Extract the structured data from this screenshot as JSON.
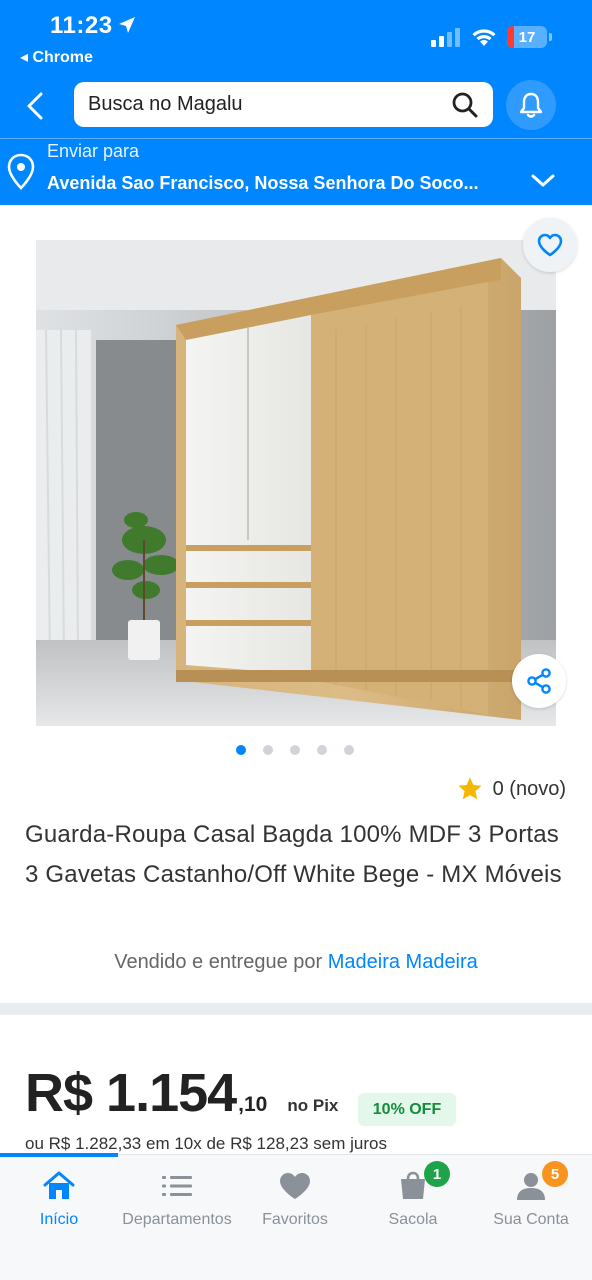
{
  "status_bar": {
    "time": "11:23",
    "back_app": "◂ Chrome",
    "battery": "17"
  },
  "header": {
    "search_placeholder": "Busca no Magalu",
    "brand_color": "#0086ff",
    "location": {
      "label": "Enviar para",
      "address": "Avenida Sao Francisco, Nossa Senhora Do Soco..."
    }
  },
  "product": {
    "image_dots": {
      "count": 5,
      "active_index": 0
    },
    "rating": "0 (novo)",
    "title": "Guarda-Roupa Casal Bagda 100% MDF 3 Portas 3 Gavetas Castanho/Off White Bege - MX Móveis",
    "seller_prefix": "Vendido e entregue por",
    "seller_name": "Madeira Madeira"
  },
  "pricing": {
    "main": "R$ 1.154",
    "cents": ",10",
    "method": "no Pix",
    "discount": "10% OFF",
    "installments": "ou R$ 1.282,33 em 10x de R$ 128,23 sem juros"
  },
  "nav": {
    "items": [
      {
        "label": "Início",
        "icon": "home-icon",
        "active": true
      },
      {
        "label": "Departamentos",
        "icon": "list-icon"
      },
      {
        "label": "Favoritos",
        "icon": "heart-icon"
      },
      {
        "label": "Sacola",
        "icon": "bag-icon",
        "badge": "1"
      },
      {
        "label": "Sua Conta",
        "icon": "user-icon",
        "badge": "5"
      }
    ]
  }
}
